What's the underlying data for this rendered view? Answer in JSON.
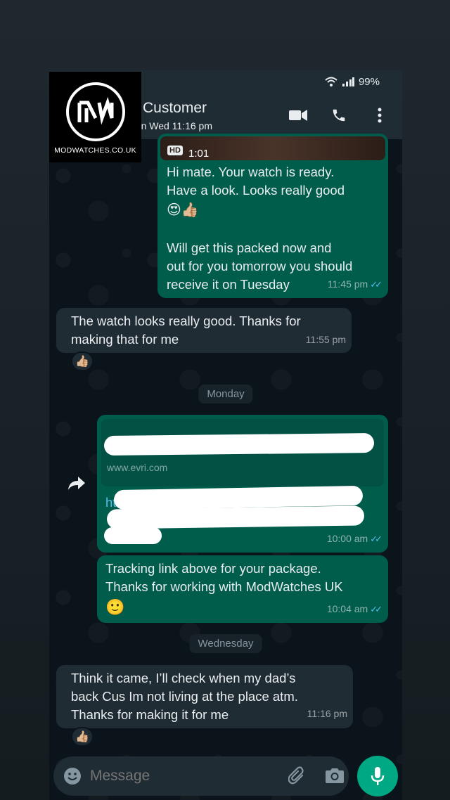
{
  "status_bar": {
    "battery": "99%"
  },
  "header": {
    "contact_name": "Customer",
    "last_seen": "een Wed 11:16 pm",
    "logo_text": "MODWATCHES.CO.UK"
  },
  "messages": {
    "video": {
      "hd_badge": "HD",
      "duration": "1:01"
    },
    "m1": {
      "line1": "Hi mate. Your watch is ready.",
      "line2": "Have a look. Looks really good",
      "emojis": "😍👍🏼",
      "line3": "Will get this packed now and",
      "line4": "out for you tomorrow you should",
      "line5": "receive it on Tuesday",
      "time": "11:45 pm"
    },
    "m2": {
      "line1": "The watch looks really good. Thanks for",
      "line2": "making that for me",
      "time": "11:55 pm",
      "reaction": "👍🏼"
    },
    "date1": "Monday",
    "m3": {
      "link_domain": "www.evri.com",
      "link_prefix": "ht",
      "time": "10:00 am"
    },
    "m4": {
      "line1": "Tracking link above for your package.",
      "line2": "Thanks for working with ModWatches UK",
      "emoji": "🙂",
      "time": "10:04 am"
    },
    "date2": "Wednesday",
    "m5": {
      "line1": "Think it came, I’ll check when my dad’s",
      "line2": "back Cus Im not living at the place atm.",
      "line3": "Thanks for making it for me",
      "time": "11:16 pm",
      "reaction": "👍🏼"
    }
  },
  "composer": {
    "placeholder": "Message"
  },
  "colors": {
    "outgoing_bubble": "#005c4b",
    "incoming_bubble": "#202c33",
    "accent": "#00a884",
    "read_ticks": "#53bdeb"
  }
}
